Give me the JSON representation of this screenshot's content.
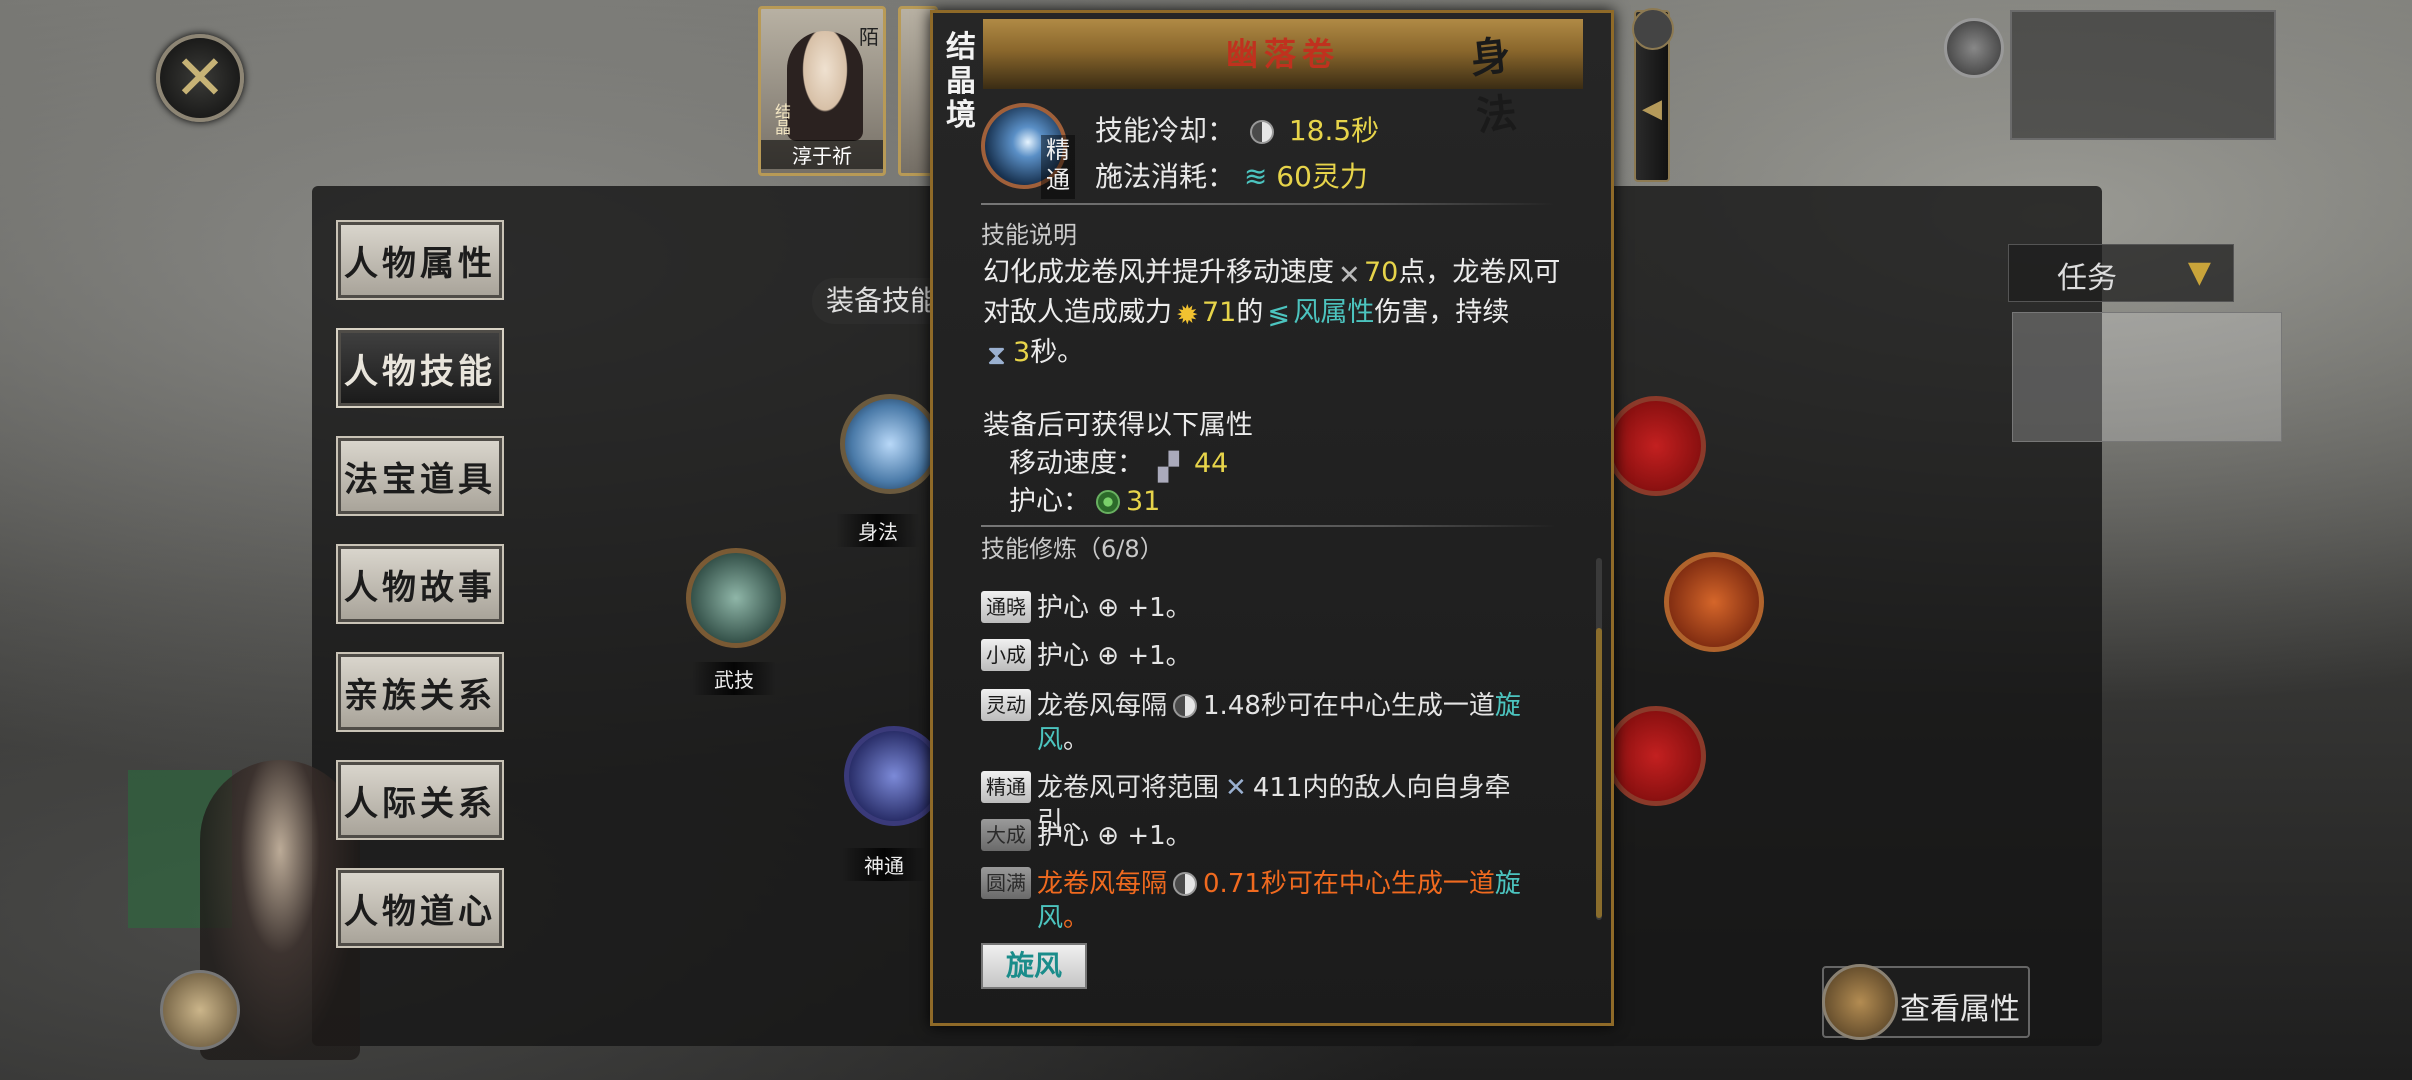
{
  "close_label": "✕",
  "left_menu": [
    "人物属性",
    "人物技能",
    "法宝道具",
    "人物故事",
    "亲族关系",
    "人际关系",
    "人物道心"
  ],
  "portrait": {
    "name": "淳于祈",
    "badge": "结晶",
    "tag": "陌"
  },
  "equip_skills_label": "装备技能",
  "skills_on_board": {
    "body": "身法",
    "martial": "武技",
    "divine": "神通"
  },
  "view_attributes_label": "查看属性",
  "task": {
    "label": "任务",
    "arrow": "▼"
  },
  "tooltip": {
    "realm": "结晶境",
    "skill_name": "幽落卷",
    "skill_type": "身法",
    "mastery": "精通",
    "cooldown_label": "技能冷却：",
    "cooldown_value": "18.5秒",
    "cost_label": "施法消耗：",
    "cost_value": "60灵力",
    "desc_title": "技能说明",
    "desc": {
      "p1": "幻化成龙卷风并提升移动速度",
      "v1": "70",
      "p2": "点，龙卷风可对敌人造成威力",
      "v2": "71",
      "p3": "的",
      "attr": "风属性",
      "p4": "伤害，持续",
      "v3": "3",
      "p5": "秒。"
    },
    "gain_title": "装备后可获得以下属性",
    "gains": [
      {
        "label": "移动速度：",
        "value": "44"
      },
      {
        "label": "护心：",
        "value": "31"
      }
    ],
    "train_title": "技能修炼（6/8）",
    "train": [
      {
        "tag": "通晓",
        "text": "护心 ⊕ +1。"
      },
      {
        "tag": "小成",
        "text": "护心 ⊕ +1。"
      },
      {
        "tag": "灵动",
        "text_a": "龙卷风每隔",
        "value": "1.48秒可在中心生成一道",
        "teal": "旋风",
        "text_b": "。"
      },
      {
        "tag": "精通",
        "text_a": "龙卷风可将范围",
        "value": "411内的敌人向自身牵引。"
      },
      {
        "tag": "大成",
        "text": "护心 ⊕ +1。"
      },
      {
        "tag": "圆满",
        "text_a": "龙卷风每隔",
        "value": "0.71秒可在中心生成一道",
        "teal": "旋风",
        "text_b": "。"
      }
    ],
    "tag_button": "旋风"
  }
}
